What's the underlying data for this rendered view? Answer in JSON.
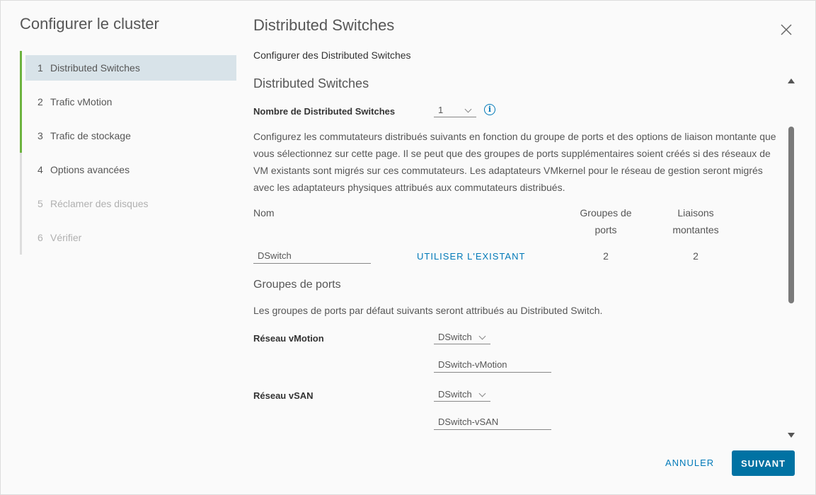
{
  "sidebar": {
    "title": "Configurer le cluster",
    "steps": [
      {
        "num": "1",
        "label": "Distributed Switches"
      },
      {
        "num": "2",
        "label": "Trafic vMotion"
      },
      {
        "num": "3",
        "label": "Trafic de stockage"
      },
      {
        "num": "4",
        "label": "Options avancées"
      },
      {
        "num": "5",
        "label": "Réclamer des disques"
      },
      {
        "num": "6",
        "label": "Vérifier"
      }
    ]
  },
  "main": {
    "title": "Distributed Switches",
    "subtitle": "Configurer des Distributed Switches",
    "section1": {
      "title": "Distributed Switches",
      "count_label": "Nombre de Distributed Switches",
      "count_value": "1",
      "description": "Configurez les commutateurs distribués suivants en fonction du groupe de ports et des options de liaison montante que vous sélectionnez sur cette page. Il se peut que des groupes de ports supplémentaires soient créés si des réseaux de VM existants sont migrés sur ces commutateurs. Les adaptateurs VMkernel pour le réseau de gestion seront migrés avec les adaptateurs physiques attribués aux commutateurs distribués.",
      "table": {
        "col_name": "Nom",
        "col_portgroups": "Groupes de ports",
        "col_uplinks": "Liaisons montantes",
        "rows": [
          {
            "name": "DSwitch",
            "action": "UTILISER L'EXISTANT",
            "portgroups": "2",
            "uplinks": "2"
          }
        ]
      }
    },
    "section2": {
      "title": "Groupes de ports",
      "description": "Les groupes de ports par défaut suivants seront attribués au Distributed Switch.",
      "vmotion": {
        "label": "Réseau vMotion",
        "switch": "DSwitch",
        "portgroup": "DSwitch-vMotion"
      },
      "vsan": {
        "label": "Réseau vSAN",
        "switch": "DSwitch",
        "portgroup": "DSwitch-vSAN"
      }
    }
  },
  "footer": {
    "cancel_label": "ANNULER",
    "next_label": "SUIVANT"
  },
  "colors": {
    "accent": "#0072a3",
    "link": "#0079b8",
    "done": "#6db33f",
    "active_bg": "#d8e3e9"
  }
}
